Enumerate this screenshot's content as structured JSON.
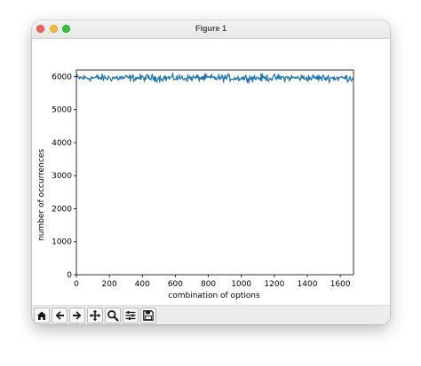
{
  "window": {
    "title": "Figure 1"
  },
  "toolbar": {
    "tools": [
      "home-icon",
      "back-arrow-icon",
      "forward-arrow-icon",
      "pan-icon",
      "zoom-icon",
      "configure-subplots-icon",
      "save-icon"
    ]
  },
  "chart_data": {
    "type": "line",
    "xlabel": "combination of options",
    "ylabel": "number of occurrences",
    "xlim": [
      0,
      1680
    ],
    "ylim": [
      0,
      6200
    ],
    "x_ticks": [
      "0",
      "200",
      "400",
      "600",
      "800",
      "1000",
      "1200",
      "1400",
      "1600"
    ],
    "y_ticks": [
      "0",
      "1000",
      "2000",
      "3000",
      "4000",
      "5000",
      "6000"
    ],
    "grid": false,
    "series": [
      {
        "color": "#1f77b4",
        "x_start": 0,
        "x_end": 1680,
        "mean": 5960,
        "min": 5750,
        "max": 6120
      }
    ]
  }
}
